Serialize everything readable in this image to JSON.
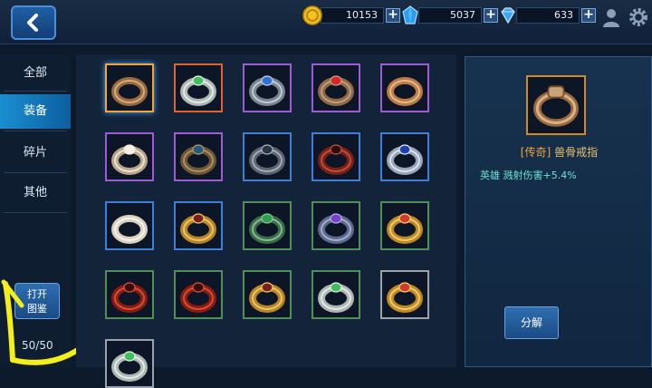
{
  "header": {
    "currencies": [
      {
        "icon": "gold-coin-icon",
        "value": "10153"
      },
      {
        "icon": "blue-crystal-icon",
        "value": "5037"
      },
      {
        "icon": "diamond-icon",
        "value": "633"
      }
    ],
    "plus_label": "+"
  },
  "sidebar": {
    "tabs": [
      {
        "label": "全部",
        "active": false
      },
      {
        "label": "装备",
        "active": true
      },
      {
        "label": "碎片",
        "active": false
      },
      {
        "label": "其他",
        "active": false
      }
    ],
    "collect_button": "打开\n图鉴",
    "counter": "50/50"
  },
  "inventory": {
    "rows": [
      [
        {
          "icon": "bone-ring-icon",
          "frame": "#f2a33a",
          "selected": true
        },
        {
          "icon": "silver-ring-icon",
          "frame": "#e0632b"
        },
        {
          "icon": "square-gem-ring-icon",
          "frame": "#9c5cd6"
        },
        {
          "icon": "ruby-ring-icon",
          "frame": "#9c5cd6"
        },
        {
          "icon": "carved-ring-icon",
          "frame": "#9c5cd6"
        }
      ],
      [
        {
          "icon": "pearl-ring-icon",
          "frame": "#9c5cd6"
        },
        {
          "icon": "signet-ring-icon",
          "frame": "#9c5cd6"
        },
        {
          "icon": "claw-ring-icon",
          "frame": "#3f7fd8"
        },
        {
          "icon": "dark-ring-icon",
          "frame": "#3f7fd8"
        },
        {
          "icon": "sapphire-ring-icon",
          "frame": "#3f7fd8"
        }
      ],
      [
        {
          "icon": "ivory-ring-icon",
          "frame": "#3f7fd8"
        },
        {
          "icon": "gold-band-icon",
          "frame": "#3f7fd8"
        },
        {
          "icon": "jade-band-icon",
          "frame": "#4f8f5a"
        },
        {
          "icon": "amethyst-ring-icon",
          "frame": "#4f8f5a"
        },
        {
          "icon": "jeweled-gold-ring-icon",
          "frame": "#4f8f5a"
        }
      ],
      [
        {
          "icon": "red-ring-icon",
          "frame": "#4f8f5a"
        },
        {
          "icon": "red-ring-icon",
          "frame": "#4f8f5a"
        },
        {
          "icon": "gold-band-icon",
          "frame": "#4f8f5a"
        },
        {
          "icon": "silver-ring-icon",
          "frame": "#4f8f5a"
        },
        {
          "icon": "jeweled-gold-ring-icon",
          "frame": "#9aa3ad"
        }
      ],
      [
        {
          "icon": "silver-ring-icon",
          "frame": "#9aa3ad"
        }
      ]
    ]
  },
  "detail": {
    "icon": "bone-ring-icon",
    "rarity": "[传奇]",
    "name": "兽骨戒指",
    "attribute": "英雄 溅射伤害+5.4%",
    "decompose_button": "分解"
  }
}
